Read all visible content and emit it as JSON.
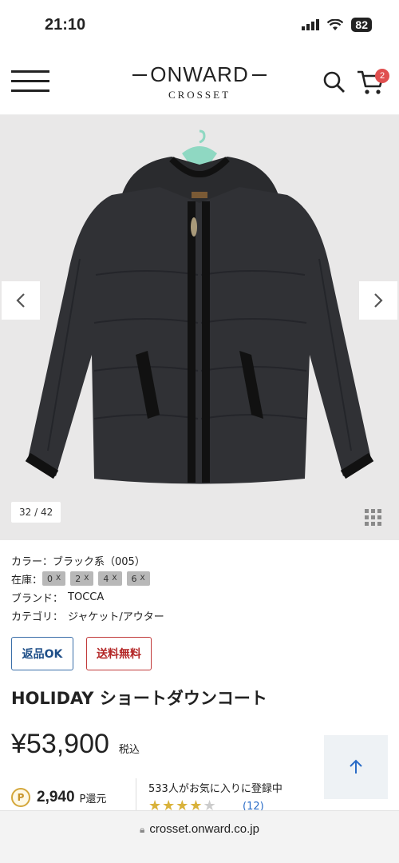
{
  "status_bar": {
    "time": "21:10",
    "battery": "82"
  },
  "header": {
    "logo_main": "ONWARD",
    "logo_sub": "CROSSET",
    "cart_count": "2"
  },
  "gallery": {
    "counter": "32 / 42",
    "prev_icon": "chevron-left-icon",
    "next_icon": "chevron-right-icon"
  },
  "details": {
    "color_label": "カラー：",
    "color_value": "ブラック系（005）",
    "stock_label": "在庫：",
    "stock_sizes": [
      "0",
      "2",
      "4",
      "6"
    ],
    "brand_label": "ブランド：",
    "brand_value": "TOCCA",
    "category_label": "カテゴリ：",
    "category_value": "ジャケット/アウター"
  },
  "tags": {
    "return": "返品OK",
    "shipping": "送料無料"
  },
  "product": {
    "title": "HOLIDAY ショートダウンコート",
    "price": "¥53,900",
    "tax": "税込"
  },
  "points": {
    "coin": "P",
    "value": "2,940",
    "unit": "P還元"
  },
  "favorites": {
    "text": "533人がお気に入りに登録中",
    "rating": 4.5,
    "review_count": "(12)"
  },
  "browser": {
    "url": "crosset.onward.co.jp"
  },
  "colors": {
    "return_tag": "#1f4f88",
    "shipping_tag": "#b42828",
    "cart_badge": "#e05050",
    "star": "#d9b23a",
    "link": "#2a6cc7"
  }
}
